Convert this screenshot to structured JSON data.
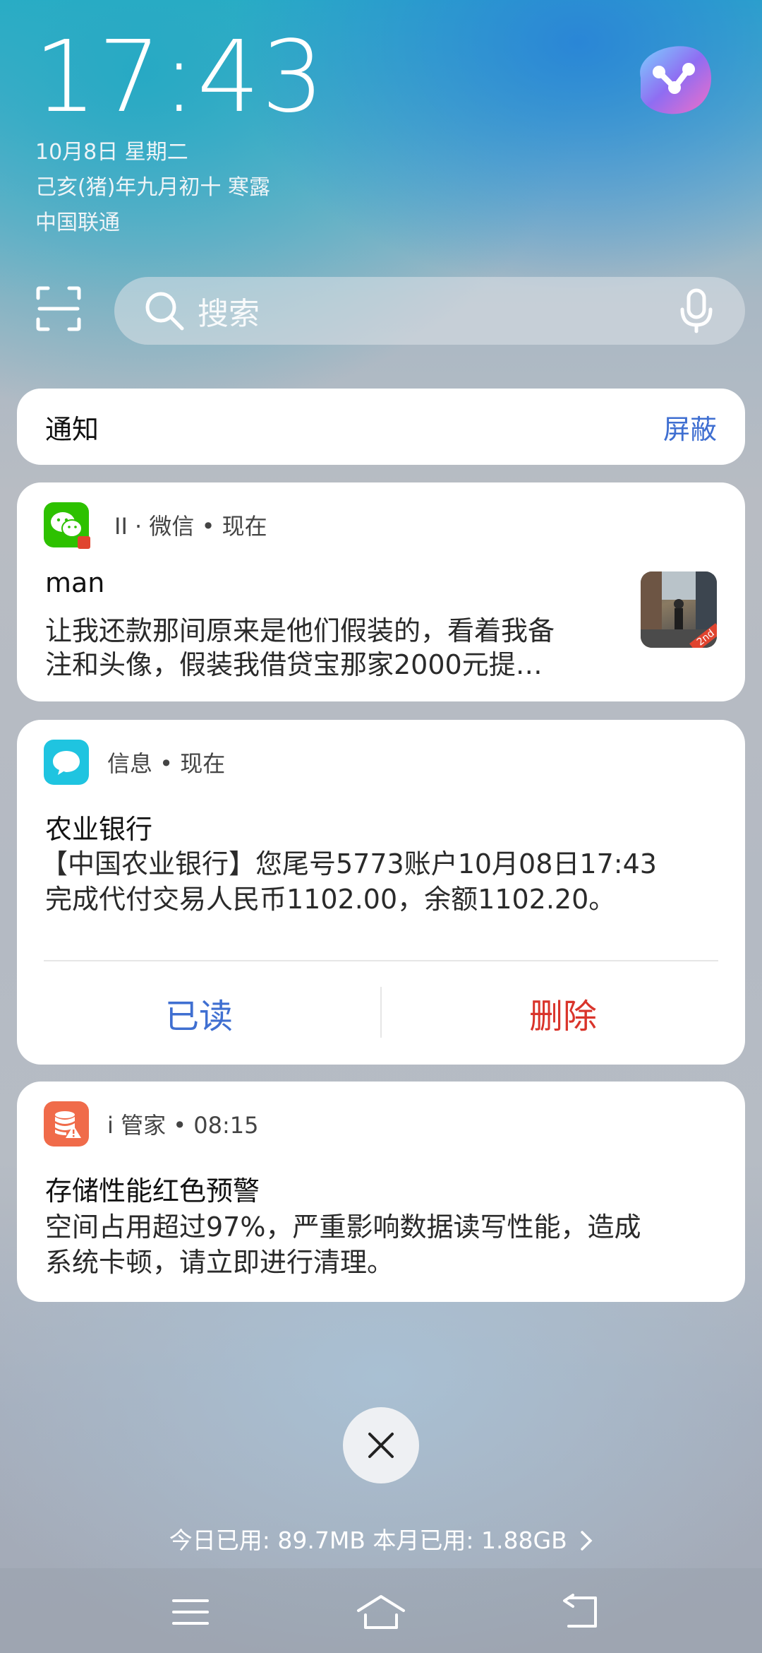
{
  "status": {
    "time": "17:43",
    "date": "10月8日 星期二",
    "lunar": "己亥(猪)年九月初十 寒露",
    "carrier": "中国联通"
  },
  "search": {
    "placeholder": "搜索"
  },
  "notice_bar": {
    "title": "通知",
    "block_label": "屏蔽"
  },
  "notifications": [
    {
      "app": "II · 微信 • 现在",
      "title": "man",
      "body_line1": "让我还款那间原来是他们假装的，看着我备",
      "body_line2": "注和头像，假装我借贷宝那家2000元提…",
      "thumb_badge": "2nd"
    },
    {
      "app": "信息 • 现在",
      "title": "农业银行",
      "body_line1": "【中国农业银行】您尾号5773账户10月08日17:43",
      "body_line2": "完成代付交易人民币1102.00，余额1102.20。",
      "actions": {
        "read": "已读",
        "delete": "删除"
      }
    },
    {
      "app": "i 管家 • 08:15",
      "title": "存储性能红色预警",
      "body_line1": "空间占用超过97%，严重影响数据读写性能，造成",
      "body_line2": "系统卡顿，请立即进行清理。"
    }
  ],
  "usage": "今日已用: 89.7MB 本月已用: 1.88GB",
  "colors": {
    "accent_blue": "#3f6fd1",
    "delete_red": "#d9342b",
    "wechat_green": "#2dc100",
    "sms_cyan": "#1fc4e0",
    "manager_orange": "#f06b4a"
  },
  "icons": {
    "assistant": "jovi-assistant-icon",
    "scan": "scan-icon",
    "search": "search-icon",
    "mic": "microphone-icon",
    "close": "close-icon",
    "menu": "menu-icon",
    "home": "home-icon",
    "back": "back-icon"
  }
}
